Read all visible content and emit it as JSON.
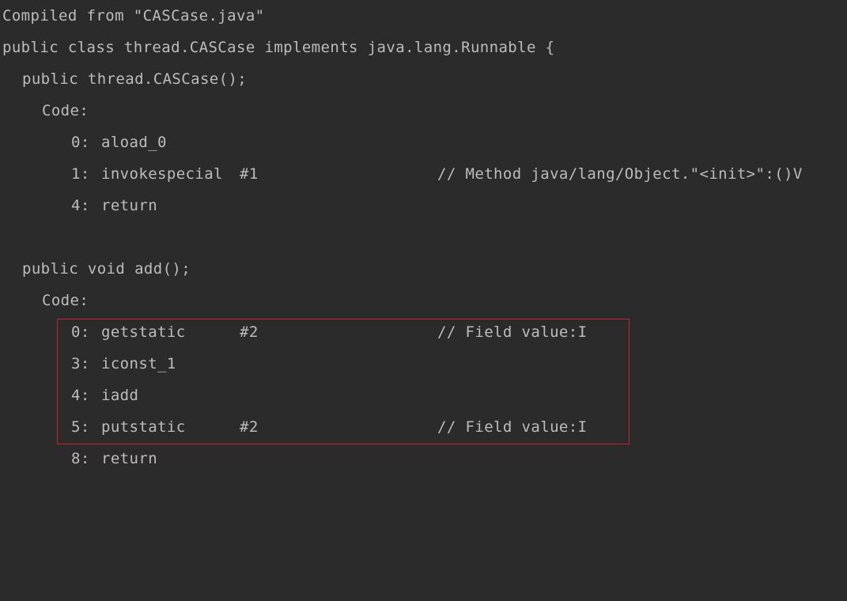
{
  "bytecode": {
    "header": "Compiled from \"CASCase.java\"",
    "class_decl": "public class thread.CASCase implements java.lang.Runnable {",
    "constructor": {
      "signature": "public thread.CASCase();",
      "code_label": "Code:",
      "instructions": [
        {
          "offset": "0:",
          "opcode": "aload_0",
          "operand": "",
          "comment": ""
        },
        {
          "offset": "1:",
          "opcode": "invokespecial",
          "operand": "#1",
          "comment": "// Method java/lang/Object.\"<init>\":()V"
        },
        {
          "offset": "4:",
          "opcode": "return",
          "operand": "",
          "comment": ""
        }
      ]
    },
    "add_method": {
      "signature": "public void add();",
      "code_label": "Code:",
      "instructions": [
        {
          "offset": "0:",
          "opcode": "getstatic",
          "operand": "#2",
          "comment": "// Field value:I"
        },
        {
          "offset": "3:",
          "opcode": "iconst_1",
          "operand": "",
          "comment": ""
        },
        {
          "offset": "4:",
          "opcode": "iadd",
          "operand": "",
          "comment": ""
        },
        {
          "offset": "5:",
          "opcode": "putstatic",
          "operand": "#2",
          "comment": "// Field value:I"
        },
        {
          "offset": "8:",
          "opcode": "return",
          "operand": "",
          "comment": ""
        }
      ]
    }
  },
  "colors": {
    "background": "#2b2b2b",
    "text": "#bcbcbc",
    "highlight_border": "#c8222a"
  }
}
